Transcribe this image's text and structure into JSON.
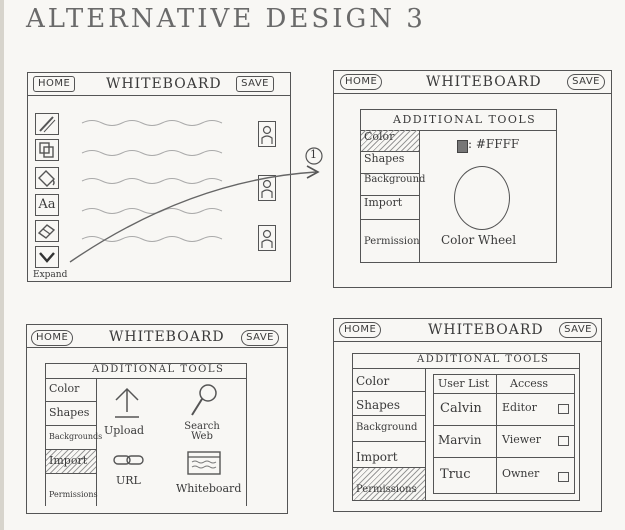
{
  "page_title": "ALTERNATIVE DESIGN 3",
  "header": {
    "home_label": "HOME",
    "app_title": "WHITEBOARD",
    "save_label": "SAVE"
  },
  "frame1": {
    "toolbar_icons": [
      "pencil-icon",
      "shapes-icon",
      "fill-bucket-icon",
      "text-icon",
      "eraser-icon",
      "chevron-down-icon"
    ],
    "text_tool_label": "Aa",
    "expand_label": "Expand",
    "user_icons": [
      "user-icon",
      "user-icon",
      "user-icon"
    ],
    "step_marker": "1"
  },
  "tools_panel": {
    "title": "ADDITIONAL TOOLS",
    "menu": [
      "Color",
      "Shapes",
      "Background",
      "Import",
      "Permission"
    ]
  },
  "frame2": {
    "color_value": ": #FFFF",
    "color_wheel_label": "Color Wheel"
  },
  "frame3": {
    "menu": [
      "Color",
      "Shapes",
      "Backgrounds",
      "Import",
      "Permissions"
    ],
    "upload_label": "Upload",
    "search_web_label": "Search Web",
    "url_label": "URL",
    "whiteboard_label": "Whiteboard"
  },
  "frame4": {
    "title": "ADDITIONAL TOOLS",
    "menu": [
      "Color",
      "Shapes",
      "Background",
      "Import",
      "Permissions"
    ],
    "columns": [
      "User List",
      "Access"
    ],
    "rows": [
      {
        "user": "Calvin",
        "access": "Editor"
      },
      {
        "user": "Marvin",
        "access": "Viewer"
      },
      {
        "user": "Truc",
        "access": "Owner"
      }
    ]
  },
  "colors": {
    "ink": "#555555",
    "paper": "#f8f7f4",
    "swatch": "#777777"
  }
}
